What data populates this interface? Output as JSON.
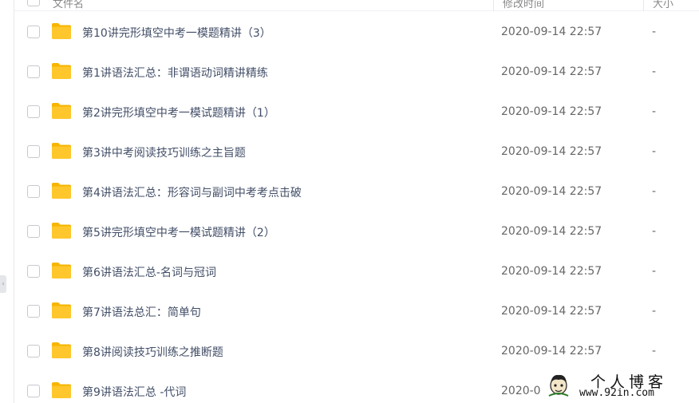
{
  "header": {
    "name_label": "文件名",
    "mtime_label": "修改时间",
    "size_label": "大小"
  },
  "colors": {
    "folder": "#ffc72c",
    "folder_back": "#f7b500",
    "name_text": "#424e67",
    "meta_text": "#666666"
  },
  "rows": [
    {
      "icon": "folder-icon",
      "name": "第10讲完形填空中考一模题精讲（3）",
      "mtime": "2020-09-14 22:57",
      "size": "-"
    },
    {
      "icon": "folder-icon",
      "name": "第1讲语法汇总：非谓语动词精讲精练",
      "mtime": "2020-09-14 22:57",
      "size": "-"
    },
    {
      "icon": "folder-icon",
      "name": "第2讲完形填空中考一模试题精讲（1）",
      "mtime": "2020-09-14 22:57",
      "size": "-"
    },
    {
      "icon": "folder-icon",
      "name": "第3讲中考阅读技巧训练之主旨题",
      "mtime": "2020-09-14 22:57",
      "size": "-"
    },
    {
      "icon": "folder-icon",
      "name": "第4讲语法汇总：形容词与副词中考考点击破",
      "mtime": "2020-09-14 22:57",
      "size": "-"
    },
    {
      "icon": "folder-icon",
      "name": "第5讲完形填空中考一模试题精讲（2）",
      "mtime": "2020-09-14 22:57",
      "size": "-"
    },
    {
      "icon": "folder-icon",
      "name": "第6讲语法汇总-名词与冠词",
      "mtime": "2020-09-14 22:57",
      "size": "-"
    },
    {
      "icon": "folder-icon",
      "name": "第7讲语法总汇：简单句",
      "mtime": "2020-09-14 22:57",
      "size": "-"
    },
    {
      "icon": "folder-icon",
      "name": "第8讲阅读技巧训练之推断题",
      "mtime": "2020-09-14 22:57",
      "size": "-"
    },
    {
      "icon": "folder-icon",
      "name": "第9讲语法汇总 -代词",
      "mtime": "2020-0",
      "size": ""
    }
  ],
  "sidebar_toggle": {
    "icon": "chevron-left-icon",
    "glyph": "‹"
  },
  "watermark": {
    "title": "个人博客",
    "url": "www.92in.com",
    "icon": "cartoon-avatar-icon"
  }
}
